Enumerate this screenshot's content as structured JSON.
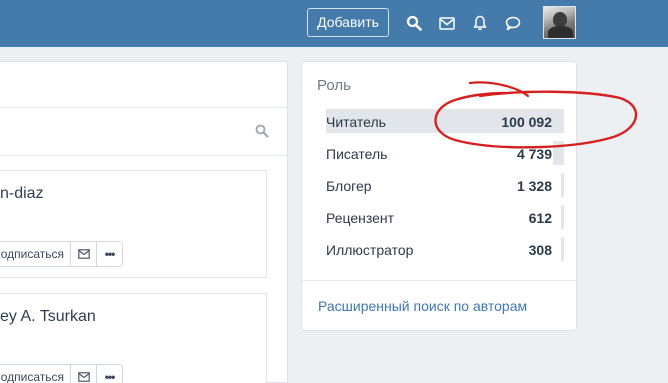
{
  "header": {
    "add_button": "Добавить",
    "icons": [
      "search-icon",
      "mail-icon",
      "bell-icon",
      "chat-icon"
    ]
  },
  "left": {
    "cards": [
      {
        "name": "n-diaz",
        "subscribe": "одписаться",
        "more": "•••"
      },
      {
        "name": "ey A. Tsurkan",
        "subscribe": "одписаться",
        "more": "•••"
      }
    ]
  },
  "roles": {
    "title": "Роль",
    "items": [
      {
        "label": "Читатель",
        "value": "100 092",
        "share": 1.0
      },
      {
        "label": "Писатель",
        "value": "4 739",
        "share": 0.047
      },
      {
        "label": "Блогер",
        "value": "1 328",
        "share": 0.013
      },
      {
        "label": "Рецензент",
        "value": "612",
        "share": 0.006
      },
      {
        "label": "Иллюстратор",
        "value": "308",
        "share": 0.003
      }
    ],
    "advanced_search": "Расширенный поиск по авторам"
  },
  "colors": {
    "header": "#447bab",
    "link": "#3f78b1",
    "annotation": "#d62020"
  }
}
